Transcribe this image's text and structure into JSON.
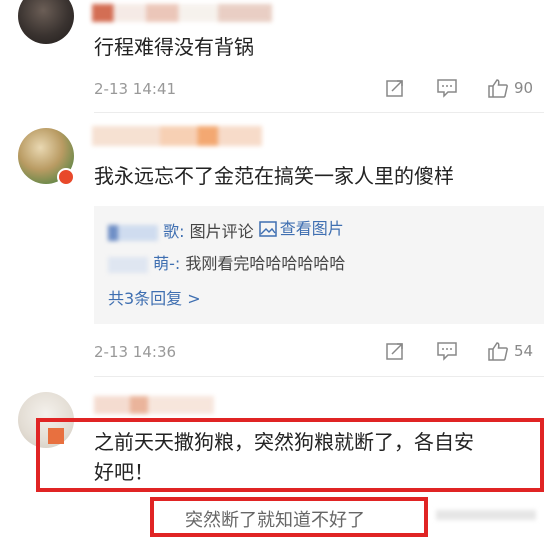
{
  "colors": {
    "text": "#222222",
    "meta": "#999999",
    "link": "#3f6fb1",
    "highlight_border": "#e02424",
    "reply_bg": "#f5f5f5"
  },
  "comments": [
    {
      "text": "行程难得没有背锅",
      "date": "2-13 14:41",
      "likes": "90",
      "icons": [
        "share-icon",
        "comment-icon",
        "like-icon"
      ]
    },
    {
      "text": "我永远忘不了金范在搞笑一家人里的傻样",
      "date": "2-13 14:36",
      "likes": "54",
      "replies": [
        {
          "user_suffix": "歌:",
          "content": "图片评论",
          "image_link": "查看图片"
        },
        {
          "user_suffix": "萌-:",
          "content": "我刚看完哈哈哈哈哈哈"
        }
      ],
      "more_replies": "共3条回复 >"
    },
    {
      "text_line1": "之前天天撒狗粮，突然狗粮就断了，各自安",
      "text_line2": "好吧！"
    }
  ],
  "partial_reply": {
    "text": "突然断了就知道不好了"
  }
}
